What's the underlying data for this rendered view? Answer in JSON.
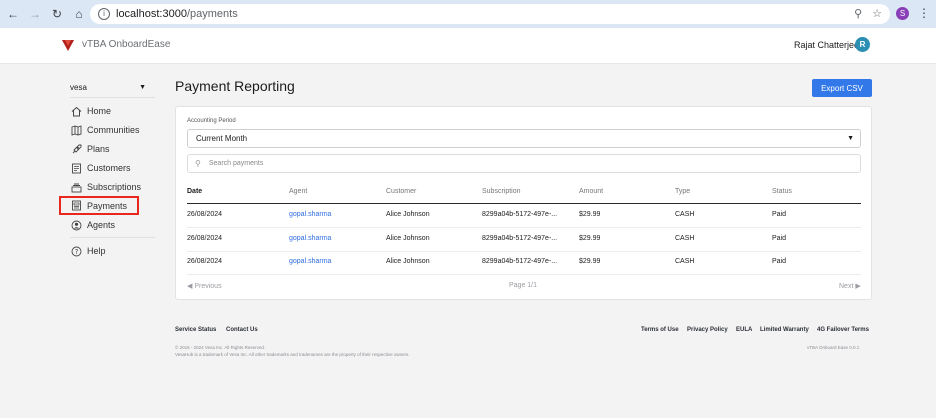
{
  "browser": {
    "url_host": "localhost:3000",
    "url_path": "/payments",
    "profile_initial": "S"
  },
  "header": {
    "brand": "vTBA OnboardEase",
    "user_name": "Rajat Chatterjee",
    "user_initial": "R",
    "logo_color": "#b3201c"
  },
  "sidebar": {
    "org": "vesa",
    "items": [
      {
        "label": "Home",
        "icon": "home-icon"
      },
      {
        "label": "Communities",
        "icon": "map-icon"
      },
      {
        "label": "Plans",
        "icon": "rocket-icon"
      },
      {
        "label": "Customers",
        "icon": "document-icon"
      },
      {
        "label": "Subscriptions",
        "icon": "stack-icon"
      },
      {
        "label": "Payments",
        "icon": "receipt-icon"
      },
      {
        "label": "Agents",
        "icon": "agent-icon"
      }
    ],
    "help_label": "Help"
  },
  "main": {
    "title": "Payment Reporting",
    "export_label": "Export CSV",
    "period_label": "Accounting Period",
    "period_value": "Current Month",
    "search_placeholder": "Search payments",
    "columns": [
      "Date",
      "Agent",
      "Customer",
      "Subscription",
      "Amount",
      "Type",
      "Status"
    ],
    "rows": [
      {
        "date": "26/08/2024",
        "agent": "gopal.sharma",
        "customer": "Alice Johnson",
        "subscription": "8299a04b-5172-497e-...",
        "amount": "$29.99",
        "type": "CASH",
        "status": "Paid"
      },
      {
        "date": "26/08/2024",
        "agent": "gopal.sharma",
        "customer": "Alice Johnson",
        "subscription": "8299a04b-5172-497e-...",
        "amount": "$29.99",
        "type": "CASH",
        "status": "Paid"
      },
      {
        "date": "26/08/2024",
        "agent": "gopal.sharma",
        "customer": "Alice Johnson",
        "subscription": "8299a04b-5172-497e-...",
        "amount": "$29.99",
        "type": "CASH",
        "status": "Paid"
      }
    ],
    "pager": {
      "prev": "Previous",
      "page": "Page 1/1",
      "next": "Next"
    }
  },
  "footer": {
    "left_links": [
      "Service Status",
      "Contact Us"
    ],
    "right_links": [
      "Terms of Use",
      "Privacy Policy",
      "EULA",
      "Limited Warranty",
      "4G Failover Terms"
    ],
    "copyright": "© 2016 - 2024 Vesa Inc. All Rights Reserved.",
    "trademark": "VesaHub is a trademark of Vesa Inc. All other trademarks and tradenames are the property of their respective owners.",
    "version": "vTBA Onboard Ease 0.0.1"
  },
  "colors": {
    "accent": "#3378e9",
    "highlight_border": "#e8271f",
    "link": "#2f6ee0"
  }
}
